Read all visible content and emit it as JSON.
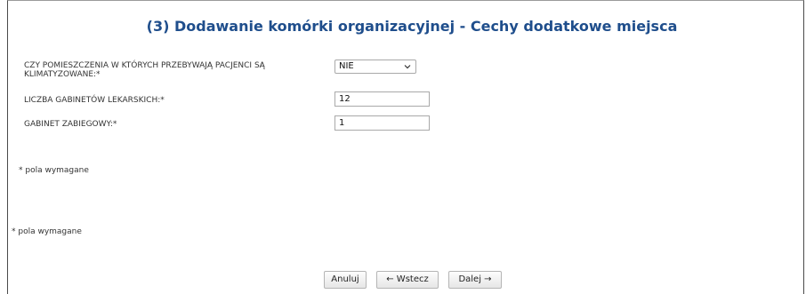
{
  "header": {
    "title": "(3) Dodawanie komórki organizacyjnej - Cechy dodatkowe miejsca"
  },
  "form": {
    "air_conditioning": {
      "label": "CZY POMIESZCZENIA W KTÓRYCH PRZEBYWAJĄ PACJENCI SĄ KLIMATYZOWANE:*",
      "value": "NIE"
    },
    "doctor_offices": {
      "label": "LICZBA GABINETÓW LEKARSKICH:*",
      "value": "12"
    },
    "treatment_room": {
      "label": "GABINET ZABIEGOWY:*",
      "value": "1"
    }
  },
  "notes": {
    "required_1": "* pola wymagane",
    "required_2": "* pola wymagane"
  },
  "buttons": {
    "cancel": "Anuluj",
    "back": "← Wstecz",
    "next": "Dalej →"
  },
  "colors": {
    "title": "#1f4e8c"
  }
}
